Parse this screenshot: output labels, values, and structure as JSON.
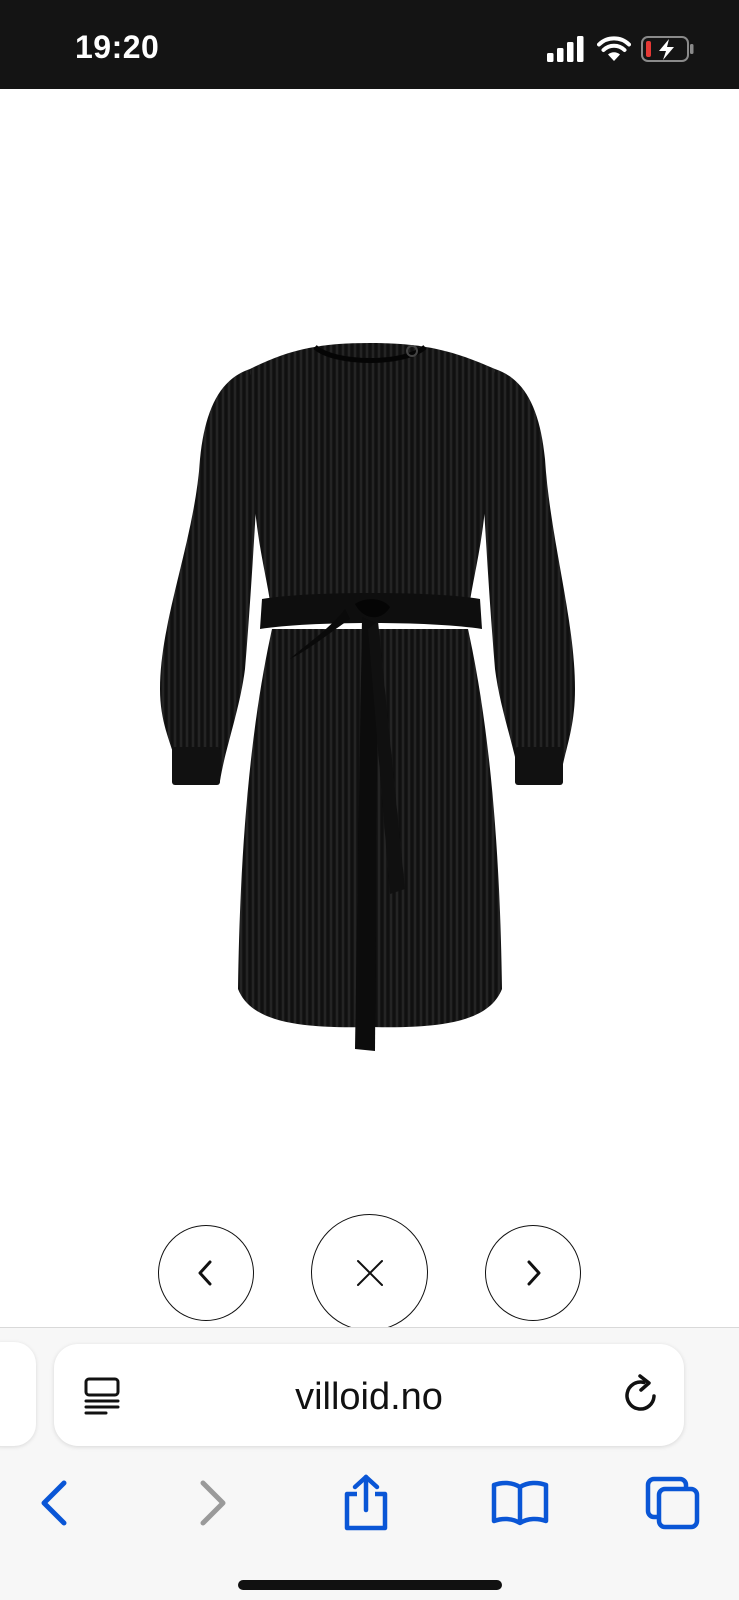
{
  "status_bar": {
    "time": "19:20",
    "icons": [
      "cellular-signal-icon",
      "wifi-icon",
      "battery-charging-icon"
    ],
    "background": "#141414",
    "battery_low_color": "#e53935"
  },
  "gallery": {
    "image_description_icon": "black-pleated-dress-image",
    "prev_icon": "chevron-left-icon",
    "close_icon": "close-icon",
    "next_icon": "chevron-right-icon"
  },
  "browser": {
    "url": "villoid.no",
    "reader_icon": "reader-mode-icon",
    "reload_icon": "reload-icon",
    "toolbar": [
      "back-icon",
      "forward-icon",
      "share-icon",
      "bookmarks-icon",
      "tabs-icon"
    ],
    "accent_color": "#0a56d6",
    "disabled_color": "#9a9a9a"
  }
}
